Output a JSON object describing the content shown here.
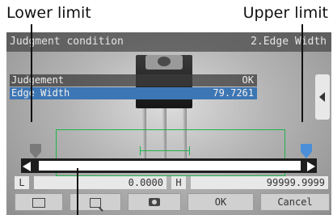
{
  "callouts": {
    "lower_limit": "Lower limit",
    "upper_limit": "Upper limit"
  },
  "title_bar": {
    "left": "Judgment condition",
    "right": "2.Edge Width"
  },
  "results": {
    "judgement_label": "Judgement",
    "judgement_value": "OK",
    "edge_label": "Edge Width",
    "edge_value": "79.7261"
  },
  "limits": {
    "lower_tag": "L",
    "lower_value": "0.0000",
    "upper_tag": "H",
    "upper_value": "99999.9999"
  },
  "buttons": {
    "ok": "OK",
    "cancel": "Cancel"
  },
  "icons": [
    "fit-frame-icon",
    "zoom-window-icon",
    "camera-icon",
    "scroll-left-icon"
  ],
  "colors": {
    "selected_row": "#3d76b4",
    "measure_window": "#1fb34a",
    "upper_handle": "#4a8fd8"
  }
}
